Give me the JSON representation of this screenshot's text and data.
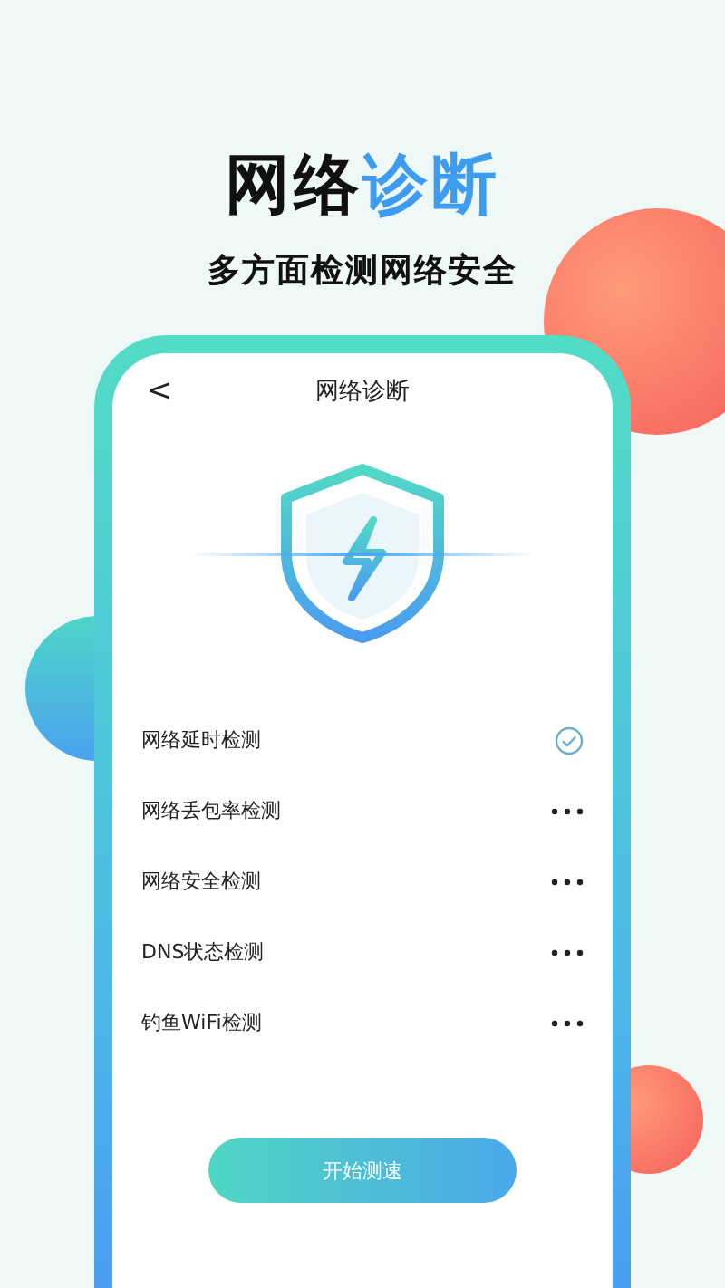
{
  "headline": {
    "parts": [
      {
        "text": "网络",
        "accent": false
      },
      {
        "text": "诊断",
        "accent": true
      }
    ]
  },
  "subtitle": "多方面检测网络安全",
  "phone": {
    "back": "<",
    "title": "网络诊断",
    "checks": [
      {
        "label": "网络延时检测",
        "done": true
      },
      {
        "label": "网络丢包率检测",
        "done": false
      },
      {
        "label": "网络安全检测",
        "done": false
      },
      {
        "label": "DNS状态检测",
        "done": false
      },
      {
        "label": "钓鱼WiFi检测",
        "done": false
      }
    ],
    "button": "开始测速"
  }
}
